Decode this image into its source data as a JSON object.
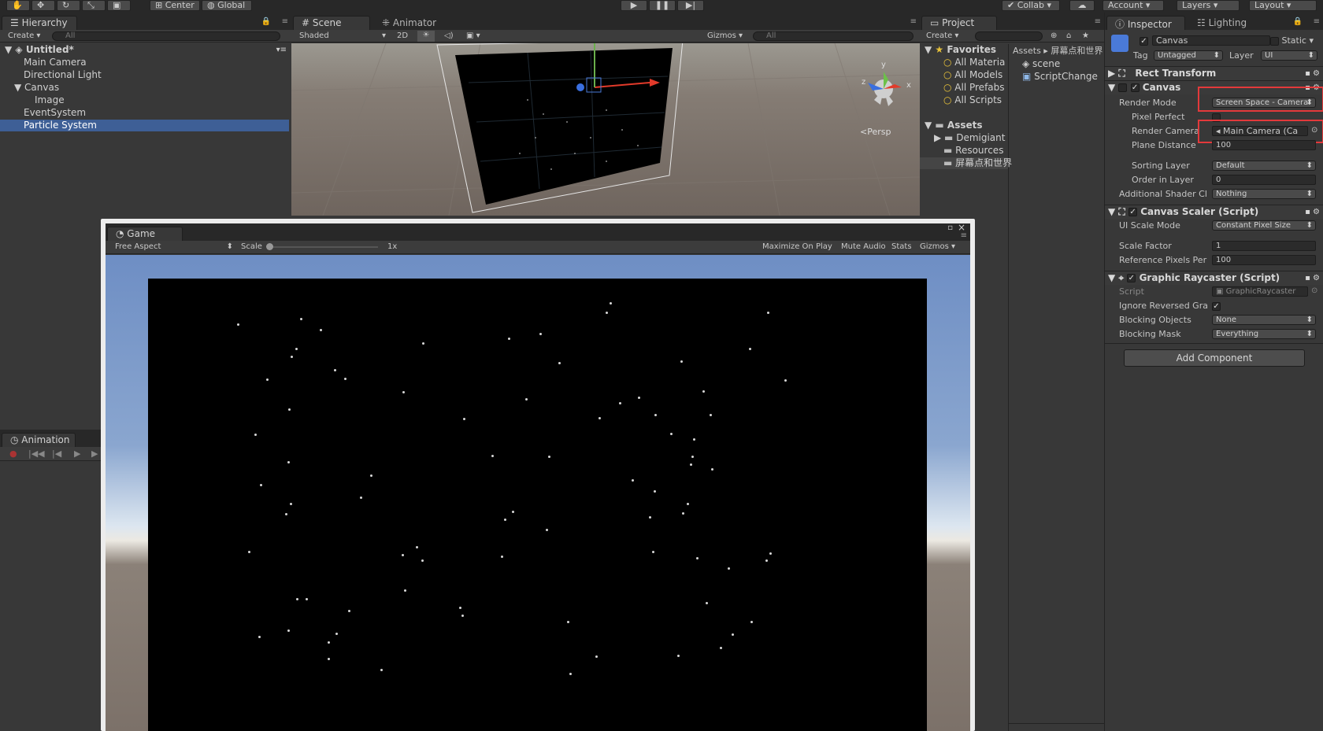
{
  "toolbar": {
    "pivot": "Center",
    "space": "Global",
    "collab": "Collab",
    "account": "Account",
    "layers": "Layers",
    "layout": "Layout"
  },
  "hierarchy": {
    "tab": "Hierarchy",
    "create": "Create",
    "search_placeholder": "All",
    "scene": "Untitled*",
    "items": [
      {
        "label": "Main Camera"
      },
      {
        "label": "Directional Light"
      },
      {
        "label": "Canvas"
      },
      {
        "label": "Image"
      },
      {
        "label": "EventSystem"
      },
      {
        "label": "Particle System"
      }
    ]
  },
  "animation": {
    "tab": "Animation"
  },
  "scene_view": {
    "tab_scene": "Scene",
    "tab_animator": "Animator",
    "shading": "Shaded",
    "mode_2d": "2D",
    "gizmos": "Gizmos",
    "search_placeholder": "All",
    "persp": "Persp",
    "axis_x": "x",
    "axis_y": "y",
    "axis_z": "z"
  },
  "game_view": {
    "tab": "Game",
    "aspect": "Free Aspect",
    "scale_label": "Scale",
    "scale_value": "1x",
    "maximize": "Maximize On Play",
    "mute": "Mute Audio",
    "stats": "Stats",
    "gizmos": "Gizmos"
  },
  "project": {
    "tab": "Project",
    "create": "Create",
    "favorites_header": "Favorites",
    "favorites": [
      "All Materia",
      "All Models",
      "All Prefabs",
      "All Scripts"
    ],
    "assets_header": "Assets",
    "folders": [
      "Demigiant",
      "Resources",
      "屏幕点和世界"
    ],
    "breadcrumb_root": "Assets",
    "breadcrumb_child": "屏幕点和世界",
    "files": [
      "scene",
      "ScriptChange"
    ]
  },
  "inspector": {
    "tab": "Inspector",
    "tab_lighting": "Lighting",
    "object_name": "Canvas",
    "static_label": "Static",
    "tag_label": "Tag",
    "tag_value": "Untagged",
    "layer_label": "Layer",
    "layer_value": "UI",
    "rect_transform": "Rect Transform",
    "canvas": {
      "header": "Canvas",
      "render_mode_label": "Render Mode",
      "render_mode": "Screen Space - Camera",
      "pixel_perfect_label": "Pixel Perfect",
      "render_camera_label": "Render Camera",
      "render_camera": "Main Camera (Ca",
      "plane_distance_label": "Plane Distance",
      "plane_distance": "100",
      "sorting_layer_label": "Sorting Layer",
      "sorting_layer": "Default",
      "order_label": "Order in Layer",
      "order": "0",
      "shader_label": "Additional Shader Cl",
      "shader": "Nothing"
    },
    "scaler": {
      "header": "Canvas Scaler (Script)",
      "mode_label": "UI Scale Mode",
      "mode": "Constant Pixel Size",
      "factor_label": "Scale Factor",
      "factor": "1",
      "ref_label": "Reference Pixels Per",
      "ref": "100"
    },
    "raycaster": {
      "header": "Graphic Raycaster (Script)",
      "script_label": "Script",
      "script": "GraphicRaycaster",
      "ignore_label": "Ignore Reversed Gra",
      "blocking_label": "Blocking Objects",
      "blocking": "None",
      "mask_label": "Blocking Mask",
      "mask": "Everything"
    },
    "add_component": "Add Component"
  },
  "colors": {
    "selection": "#3e5f96",
    "highlight_box": "#e3393b",
    "sky_top": "#6f8fc4",
    "ground": "#8a8078"
  }
}
